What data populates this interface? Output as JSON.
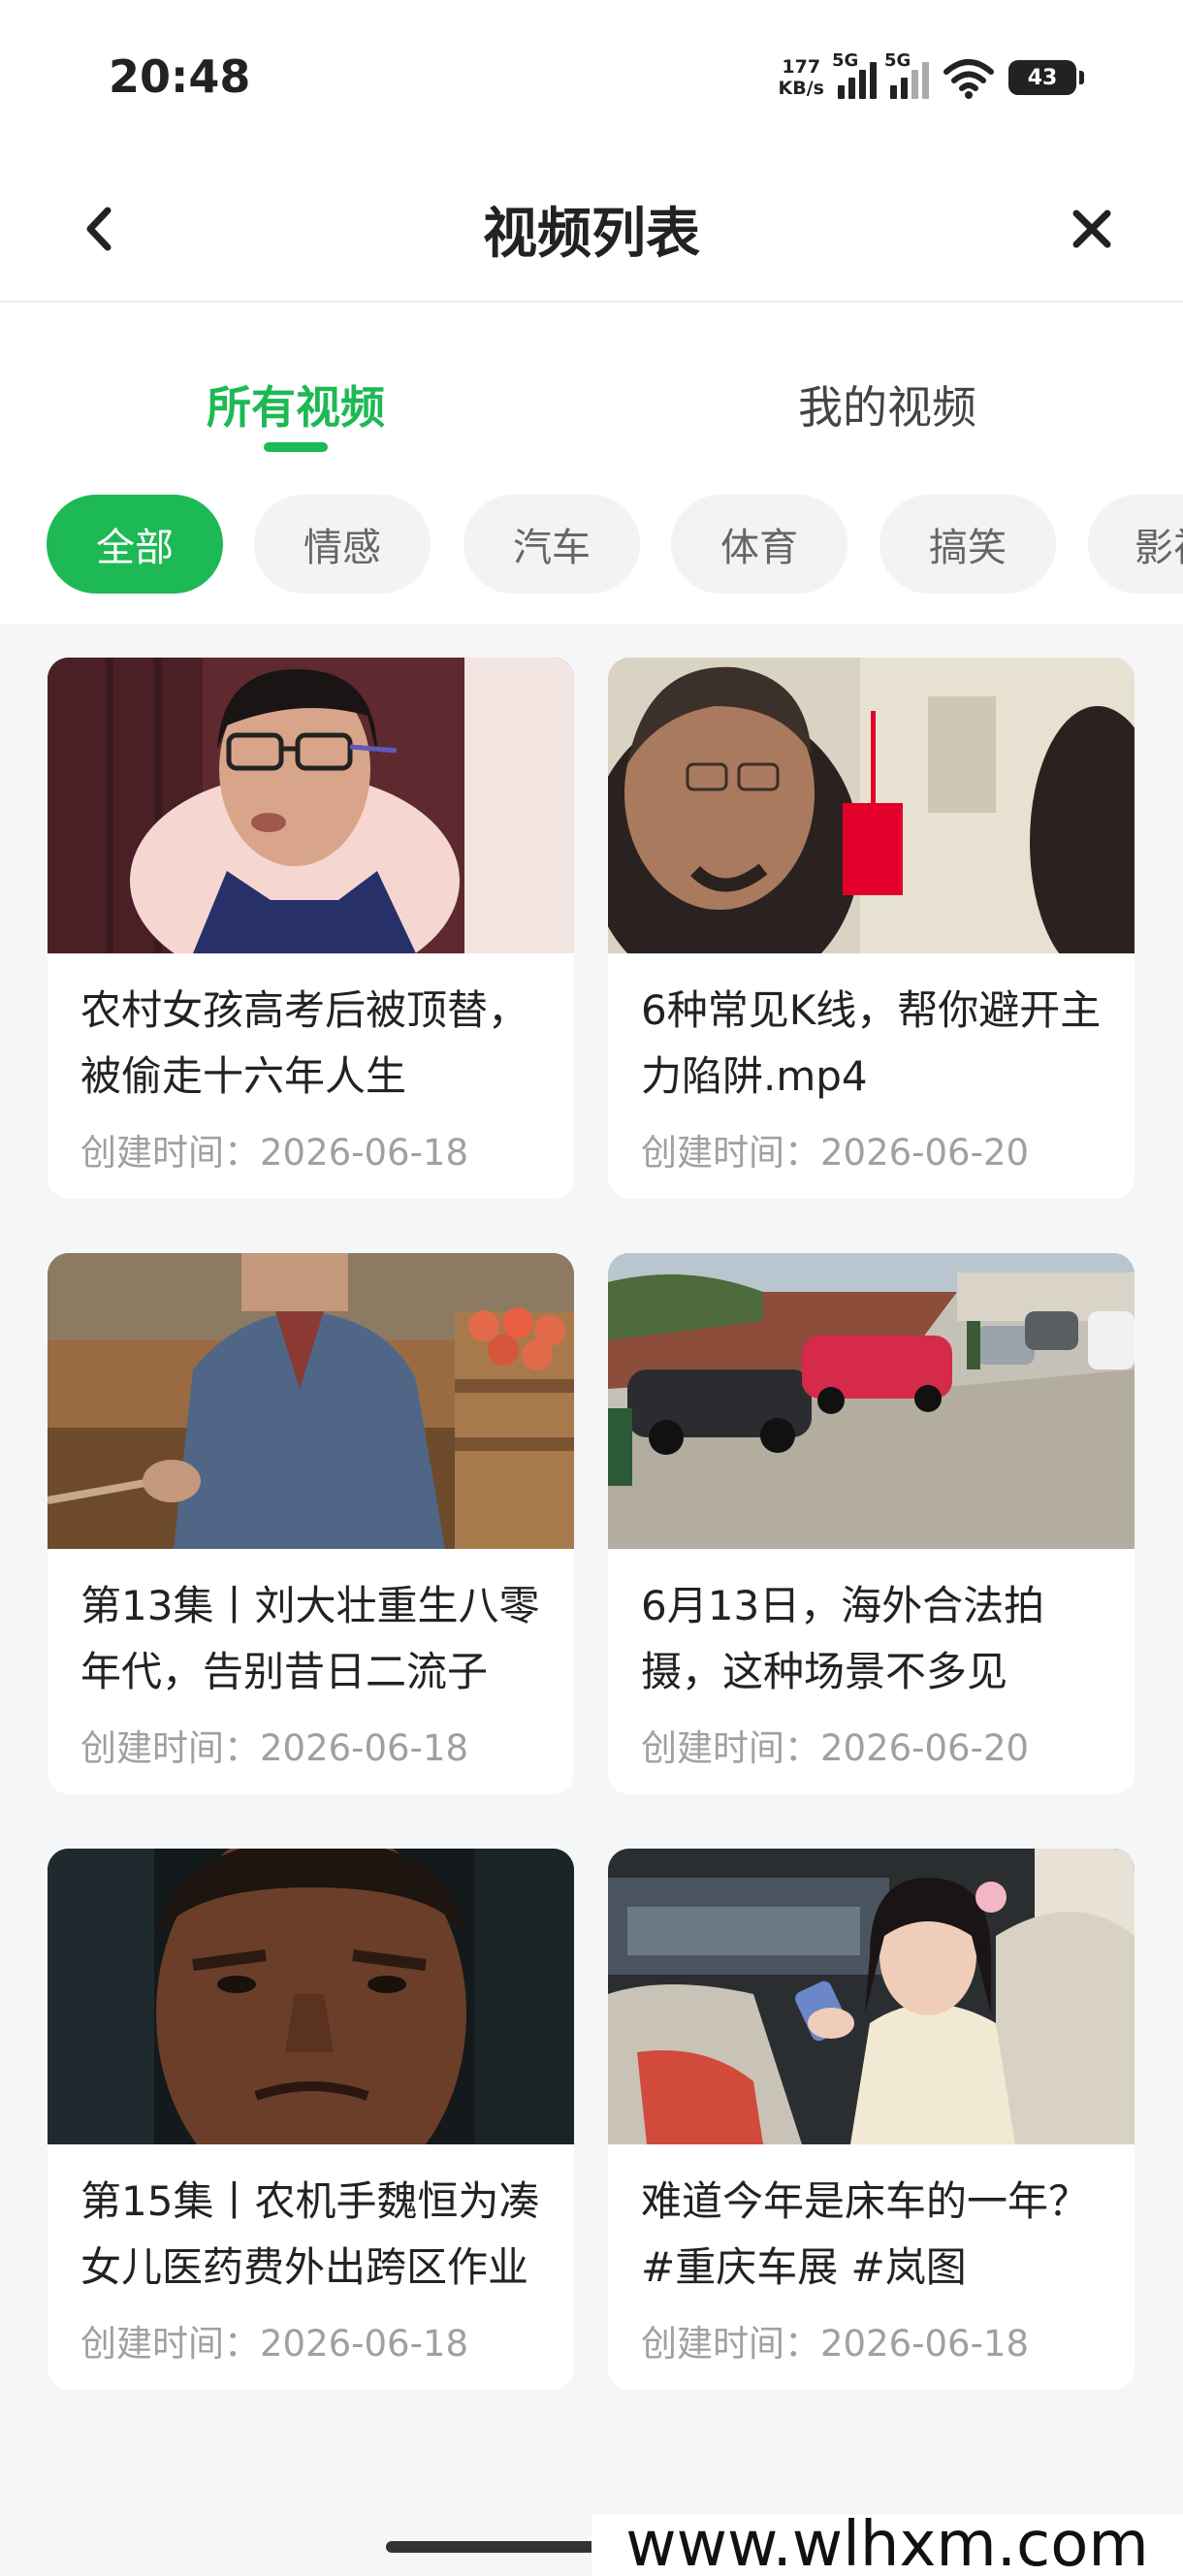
{
  "status_bar": {
    "time": "20:48",
    "net_speed_value": "177",
    "net_speed_unit": "KB/s",
    "signal1_label": "5G",
    "signal2_label": "5G",
    "battery": "43"
  },
  "header": {
    "title": "视频列表",
    "back_icon": "chevron-left-icon",
    "close_icon": "close-icon"
  },
  "tabs": [
    {
      "label": "所有视频",
      "active": true
    },
    {
      "label": "我的视频",
      "active": false
    }
  ],
  "categories": [
    "全部",
    "情感",
    "汽车",
    "体育",
    "搞笑",
    "影视"
  ],
  "accent_color": "#1db954",
  "videos": [
    {
      "title": "农村女孩高考后被顶替，被偷走十六年人生",
      "date": "创建时间：2026-06-18"
    },
    {
      "title": "6种常见K线，帮你避开主力陷阱.mp4",
      "date": "创建时间：2026-06-20"
    },
    {
      "title": "第13集丨刘大壮重生八零年代，告别昔日二流子",
      "date": "创建时间：2026-06-18"
    },
    {
      "title": "6月13日，海外合法拍摄，这种场景不多见",
      "date": "创建时间：2026-06-20"
    },
    {
      "title": "第15集丨农机手魏恒为凑女儿医药费外出跨区作业",
      "date": "创建时间：2026-06-18"
    },
    {
      "title": "难道今年是床车的一年？ #重庆车展 #岚图",
      "date": "创建时间：2026-06-18"
    }
  ],
  "watermark": "www.wlhxm.com"
}
